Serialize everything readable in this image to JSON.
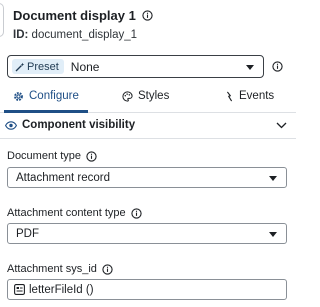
{
  "header": {
    "title": "Document display 1",
    "id_label": "ID:",
    "id_value": "document_display_1"
  },
  "preset": {
    "badge_label": "Preset",
    "value": "None"
  },
  "tabs": [
    {
      "label": "Configure",
      "icon": "gear-icon",
      "active": true
    },
    {
      "label": "Styles",
      "icon": "palette-icon",
      "active": false
    },
    {
      "label": "Events",
      "icon": "lightning-icon",
      "active": false
    }
  ],
  "section": {
    "title": "Component visibility",
    "icon": "eye-icon",
    "expanded_indicator": "chevron-down-icon"
  },
  "fields": {
    "document_type": {
      "label": "Document type",
      "value": "Attachment record"
    },
    "attachment_content_type": {
      "label": "Attachment content type",
      "value": "PDF"
    },
    "attachment_sys_id": {
      "label": "Attachment sys_id",
      "value": "letterFileId ()"
    }
  },
  "colors": {
    "accent": "#1f4f86",
    "preset_badge_bg": "#e1eef8",
    "border": "#8a9097",
    "divider": "#dde0e4"
  }
}
